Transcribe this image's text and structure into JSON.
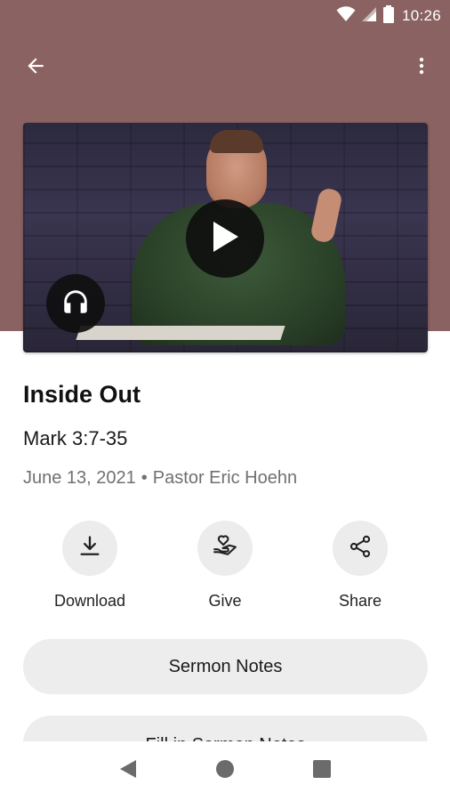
{
  "status_bar": {
    "time": "10:26"
  },
  "sermon": {
    "title": "Inside Out",
    "scripture": "Mark 3:7-35",
    "date": "June 13, 2021",
    "separator": "•",
    "speaker": "Pastor Eric Hoehn"
  },
  "actions": {
    "download_label": "Download",
    "give_label": "Give",
    "share_label": "Share"
  },
  "buttons": {
    "sermon_notes": "Sermon Notes",
    "fill_in_notes": "Fill in Sermon Notes"
  },
  "colors": {
    "header_bg": "#8a6262",
    "pill_bg": "#ededed",
    "circle_bg": "#ececec"
  },
  "icons": {
    "back": "arrow-back-icon",
    "menu": "more-vert-icon",
    "play": "play-icon",
    "audio": "headphones-icon",
    "download": "download-icon",
    "give": "give-icon",
    "share": "share-icon"
  }
}
